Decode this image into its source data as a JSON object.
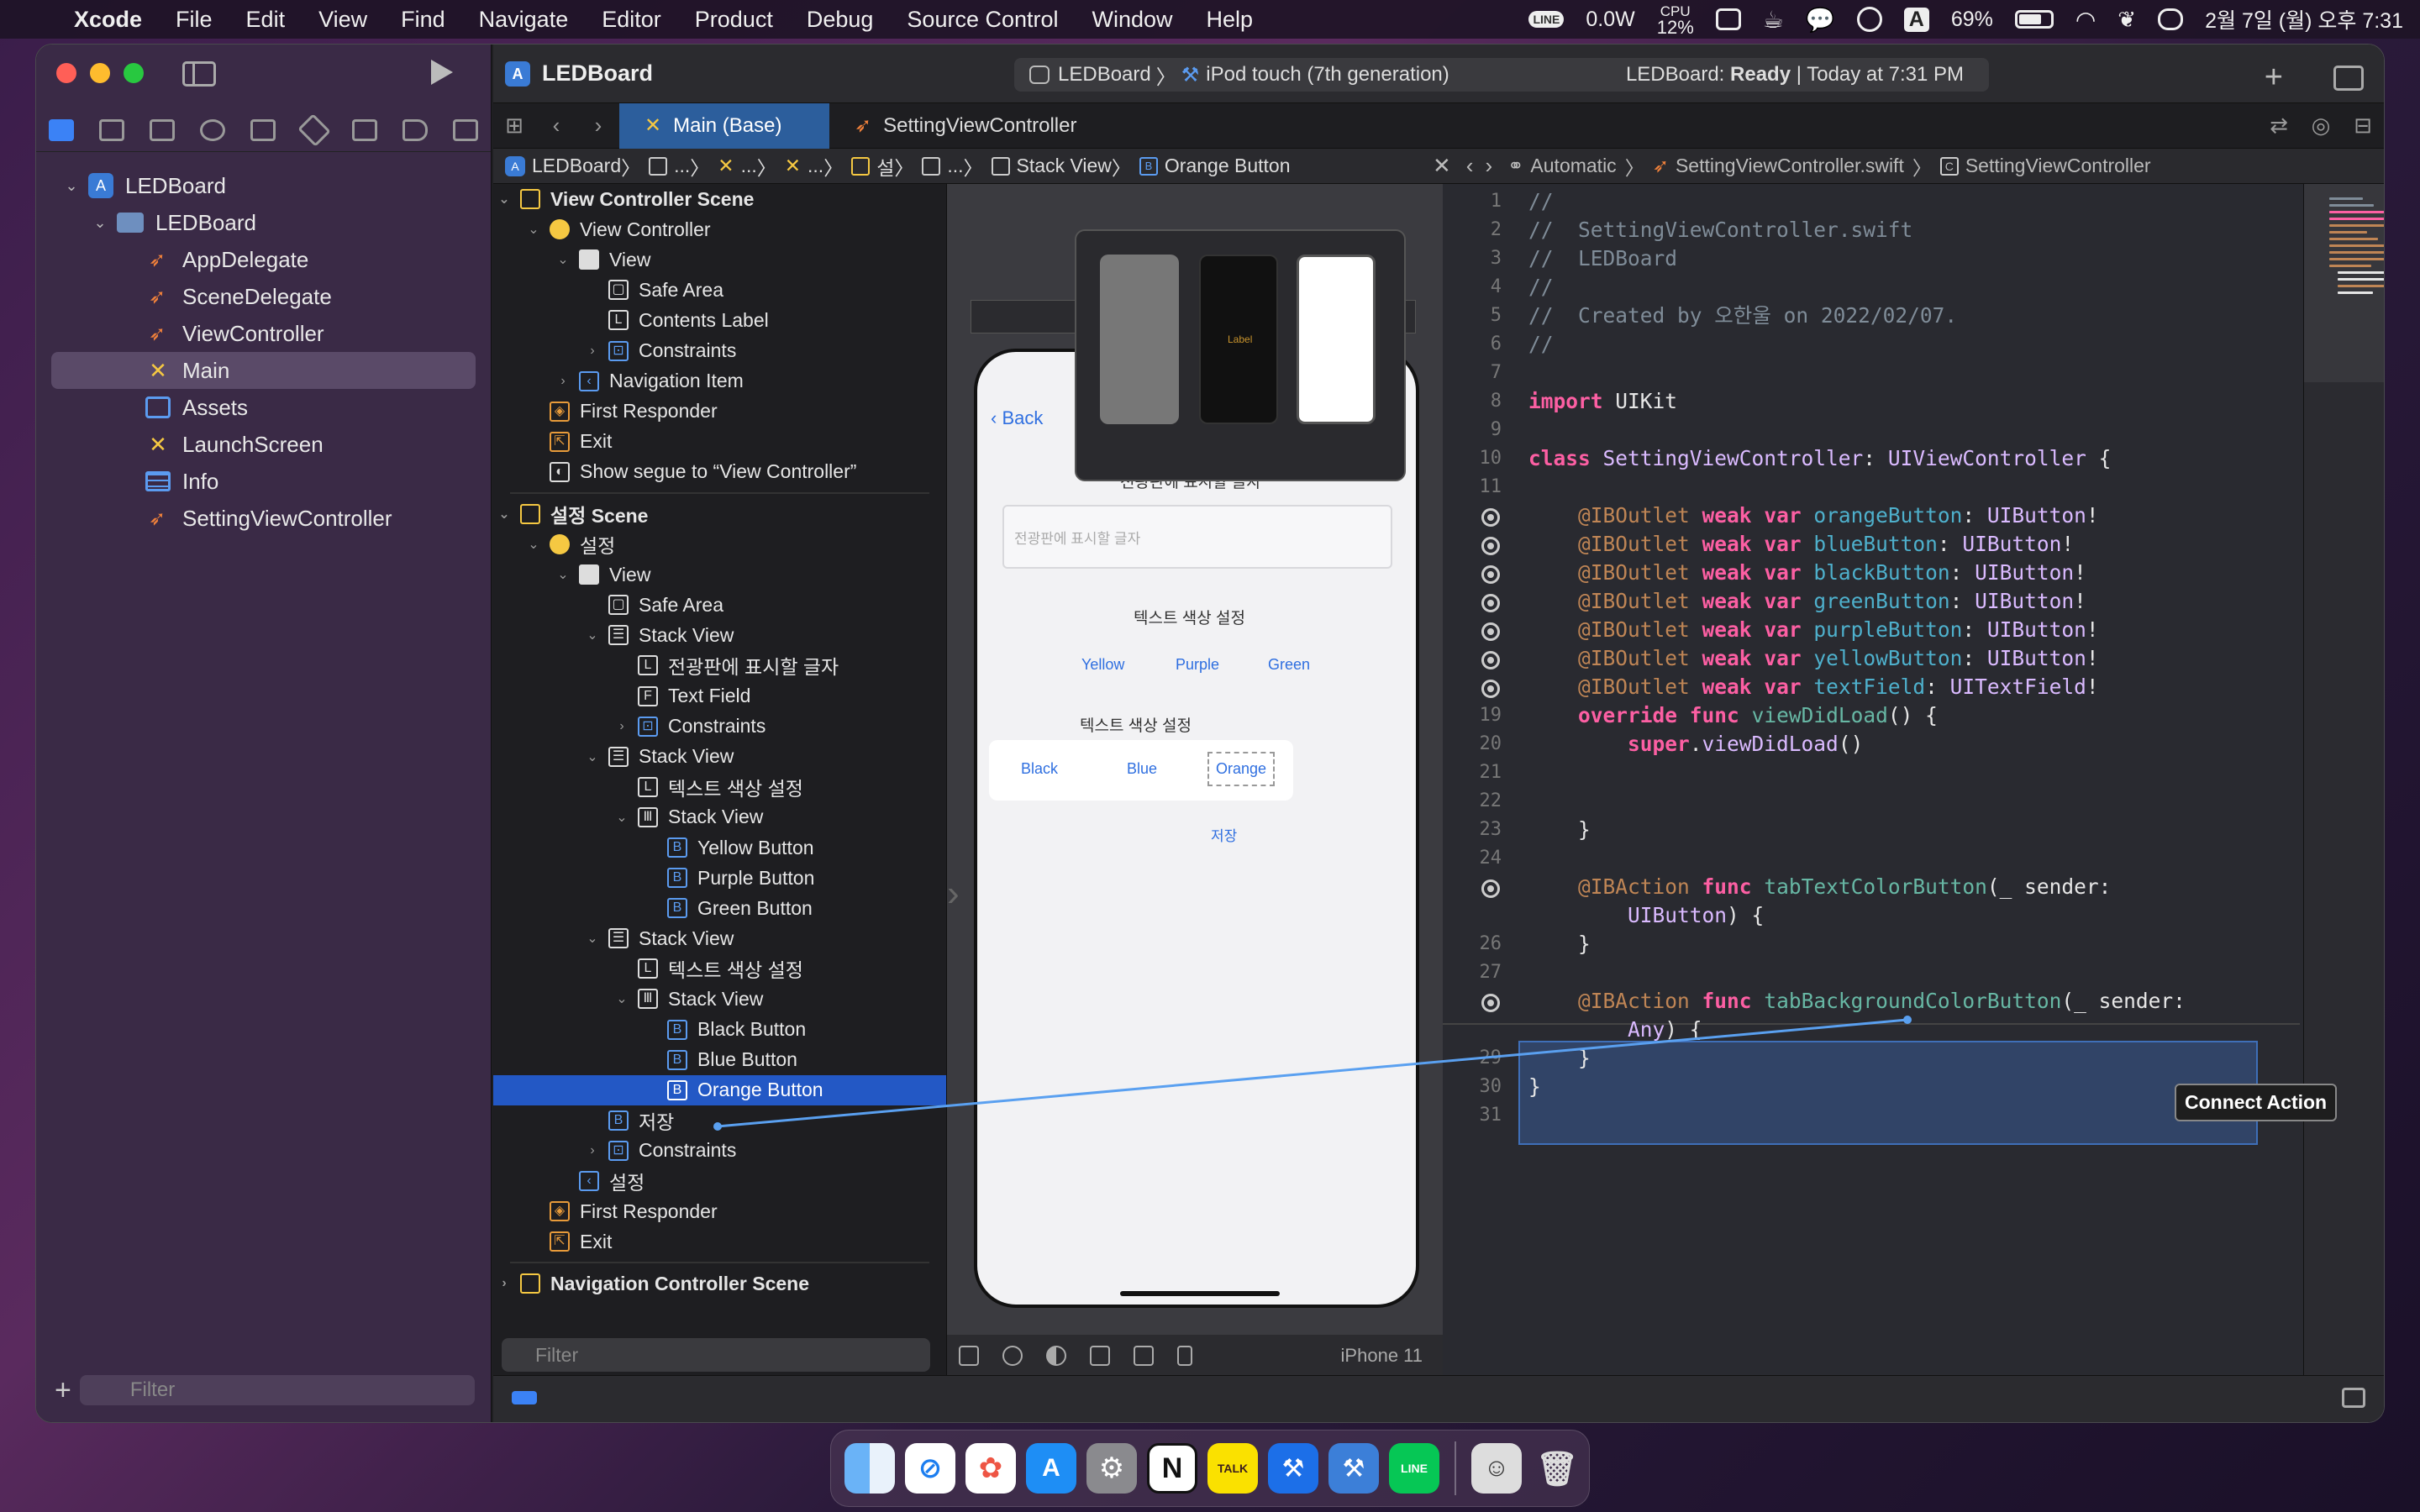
{
  "menubar": {
    "app": "Xcode",
    "items": [
      "File",
      "Edit",
      "View",
      "Find",
      "Navigate",
      "Editor",
      "Product",
      "Debug",
      "Source Control",
      "Window",
      "Help"
    ],
    "power": "0.0W",
    "cpu_label": "CPU",
    "cpu_value": "12%",
    "input_source": "A",
    "battery": "69%",
    "clock": "2월 7일 (월) 오후 7:31"
  },
  "navigator": {
    "items": [
      {
        "label": "LEDBoard",
        "kind": "project",
        "depth": 0
      },
      {
        "label": "LEDBoard",
        "kind": "folder",
        "depth": 1
      },
      {
        "label": "AppDelegate",
        "kind": "swift",
        "depth": 2
      },
      {
        "label": "SceneDelegate",
        "kind": "swift",
        "depth": 2
      },
      {
        "label": "ViewController",
        "kind": "swift",
        "depth": 2
      },
      {
        "label": "Main",
        "kind": "storyboard",
        "depth": 2,
        "selected": true
      },
      {
        "label": "Assets",
        "kind": "assets",
        "depth": 2
      },
      {
        "label": "LaunchScreen",
        "kind": "storyboard",
        "depth": 2
      },
      {
        "label": "Info",
        "kind": "plist",
        "depth": 2
      },
      {
        "label": "SettingViewController",
        "kind": "swift",
        "depth": 2
      }
    ],
    "filter_placeholder": "Filter"
  },
  "toolbar": {
    "project": "LEDBoard",
    "scheme": "LEDBoard",
    "device": "iPod touch (7th generation)",
    "status_name": "LEDBoard:",
    "status_state": "Ready",
    "status_time": "| Today at 7:31 PM"
  },
  "tabs": [
    {
      "label": "Main (Base)",
      "active": true
    },
    {
      "label": "SettingViewController",
      "active": false
    }
  ],
  "jumpbar_left": [
    "LEDBoard",
    "...",
    "...",
    "...",
    "설",
    "...",
    "Stack View",
    "Orange Button"
  ],
  "jumpbar_right": {
    "mode": "Automatic",
    "file": "SettingViewController.swift",
    "symbol": "SettingViewController"
  },
  "outline": [
    {
      "label": "View Controller Scene",
      "depth": 0,
      "icon": "scene",
      "scene": true,
      "disc": "v"
    },
    {
      "label": "View Controller",
      "depth": 1,
      "icon": "vc",
      "disc": "v"
    },
    {
      "label": "View",
      "depth": 2,
      "icon": "view",
      "disc": "v"
    },
    {
      "label": "Safe Area",
      "depth": 3,
      "icon": "safe"
    },
    {
      "label": "Contents Label",
      "depth": 3,
      "icon": "L"
    },
    {
      "label": "Constraints",
      "depth": 3,
      "icon": "constraint",
      "disc": ">"
    },
    {
      "label": "Navigation Item",
      "depth": 2,
      "icon": "<",
      "disc": ">"
    },
    {
      "label": "First Responder",
      "depth": 1,
      "icon": "responder"
    },
    {
      "label": "Exit",
      "depth": 1,
      "icon": "exit"
    },
    {
      "label": "Show segue to “View Controller”",
      "depth": 1,
      "icon": "segue"
    },
    {
      "sep": true
    },
    {
      "label": "설정 Scene",
      "depth": 0,
      "icon": "scene",
      "scene": true,
      "disc": "v"
    },
    {
      "label": "설정",
      "depth": 1,
      "icon": "vc",
      "disc": "v"
    },
    {
      "label": "View",
      "depth": 2,
      "icon": "view",
      "disc": "v"
    },
    {
      "label": "Safe Area",
      "depth": 3,
      "icon": "safe"
    },
    {
      "label": "Stack View",
      "depth": 3,
      "icon": "stack",
      "disc": "v"
    },
    {
      "label": "전광판에 표시할 글자",
      "depth": 4,
      "icon": "L"
    },
    {
      "label": "Text Field",
      "depth": 4,
      "icon": "F"
    },
    {
      "label": "Constraints",
      "depth": 4,
      "icon": "constraint",
      "disc": ">"
    },
    {
      "label": "Stack View",
      "depth": 3,
      "icon": "stack",
      "disc": "v"
    },
    {
      "label": "텍스트 색상 설정",
      "depth": 4,
      "icon": "L"
    },
    {
      "label": "Stack View",
      "depth": 4,
      "icon": "hstack",
      "disc": "v"
    },
    {
      "label": "Yellow Button",
      "depth": 5,
      "icon": "B"
    },
    {
      "label": "Purple Button",
      "depth": 5,
      "icon": "B"
    },
    {
      "label": "Green Button",
      "depth": 5,
      "icon": "B"
    },
    {
      "label": "Stack View",
      "depth": 3,
      "icon": "stack",
      "disc": "v"
    },
    {
      "label": "텍스트 색상 설정",
      "depth": 4,
      "icon": "L"
    },
    {
      "label": "Stack View",
      "depth": 4,
      "icon": "hstack",
      "disc": "v"
    },
    {
      "label": "Black Button",
      "depth": 5,
      "icon": "B"
    },
    {
      "label": "Blue Button",
      "depth": 5,
      "icon": "B"
    },
    {
      "label": "Orange Button",
      "depth": 5,
      "icon": "B",
      "selected": true
    },
    {
      "label": "저장",
      "depth": 3,
      "icon": "B"
    },
    {
      "label": "Constraints",
      "depth": 3,
      "icon": "constraint",
      "disc": ">"
    },
    {
      "label": "설정",
      "depth": 2,
      "icon": "<"
    },
    {
      "label": "First Responder",
      "depth": 1,
      "icon": "responder"
    },
    {
      "label": "Exit",
      "depth": 1,
      "icon": "exit"
    },
    {
      "sep": true
    },
    {
      "label": "Navigation Controller Scene",
      "depth": 0,
      "icon": "scene",
      "scene": true,
      "disc": ">"
    }
  ],
  "outline_filter": "Filter",
  "canvas": {
    "back": "Back",
    "heading1": "전광판에 표시할 글자",
    "field_placeholder": "전광판에 표시할 글자",
    "heading2": "텍스트 색상 설정",
    "row1": [
      "Yellow",
      "Purple",
      "Green"
    ],
    "heading3": "텍스트 색상 설정",
    "row2": [
      "Black",
      "Blue",
      "Orange"
    ],
    "save": "저장",
    "preview_label": "Label",
    "device": "iPhone 11"
  },
  "code": [
    {
      "n": "1",
      "html": "<span class='cmt'>//</span>"
    },
    {
      "n": "2",
      "html": "<span class='cmt'>//  SettingViewController.swift</span>"
    },
    {
      "n": "3",
      "html": "<span class='cmt'>//  LEDBoard</span>"
    },
    {
      "n": "4",
      "html": "<span class='cmt'>//</span>"
    },
    {
      "n": "5",
      "html": "<span class='cmt'>//  Created by 오한울 on 2022/02/07.</span>"
    },
    {
      "n": "6",
      "html": "<span class='cmt'>//</span>"
    },
    {
      "n": "7",
      "html": ""
    },
    {
      "n": "8",
      "html": "<span class='kw'>import</span> UIKit"
    },
    {
      "n": "9",
      "html": ""
    },
    {
      "n": "10",
      "html": "<span class='kw'>class</span> <span class='ty'>SettingViewController</span>: <span class='ty'>UIViewController</span> {"
    },
    {
      "n": "11",
      "html": ""
    },
    {
      "n": "",
      "dot": true,
      "html": "    <span class='attr'>@IBOutlet</span> <span class='kw'>weak</span> <span class='kw'>var</span> <span class='var'>orangeButton</span>: <span class='ty'>UIButton</span>!"
    },
    {
      "n": "",
      "dot": true,
      "html": "    <span class='attr'>@IBOutlet</span> <span class='kw'>weak</span> <span class='kw'>var</span> <span class='var'>blueButton</span>: <span class='ty'>UIButton</span>!"
    },
    {
      "n": "",
      "dot": true,
      "html": "    <span class='attr'>@IBOutlet</span> <span class='kw'>weak</span> <span class='kw'>var</span> <span class='var'>blackButton</span>: <span class='ty'>UIButton</span>!"
    },
    {
      "n": "",
      "dot": true,
      "html": "    <span class='attr'>@IBOutlet</span> <span class='kw'>weak</span> <span class='kw'>var</span> <span class='var'>greenButton</span>: <span class='ty'>UIButton</span>!"
    },
    {
      "n": "",
      "dot": true,
      "html": "    <span class='attr'>@IBOutlet</span> <span class='kw'>weak</span> <span class='kw'>var</span> <span class='var'>purpleButton</span>: <span class='ty'>UIButton</span>!"
    },
    {
      "n": "",
      "dot": true,
      "html": "    <span class='attr'>@IBOutlet</span> <span class='kw'>weak</span> <span class='kw'>var</span> <span class='var'>yellowButton</span>: <span class='ty'>UIButton</span>!"
    },
    {
      "n": "",
      "dot": true,
      "html": "    <span class='attr'>@IBOutlet</span> <span class='kw'>weak</span> <span class='kw'>var</span> <span class='var'>textField</span>: <span class='ty'>UITextField</span>!"
    },
    {
      "n": "19",
      "html": "    <span class='kw'>override</span> <span class='kw'>func</span> <span class='fn'>viewDidLoad</span>() {"
    },
    {
      "n": "20",
      "html": "        <span class='kw'>super</span>.<span class='ty'>viewDidLoad</span>()"
    },
    {
      "n": "21",
      "html": ""
    },
    {
      "n": "22",
      "html": ""
    },
    {
      "n": "23",
      "html": "    }"
    },
    {
      "n": "24",
      "html": ""
    },
    {
      "n": "",
      "dot": true,
      "html": "    <span class='attr'>@IBAction</span> <span class='kw'>func</span> <span class='fn'>tabTextColorButton</span>(_ sender:"
    },
    {
      "n": "",
      "html": "        <span class='ty'>UIButton</span>) {"
    },
    {
      "n": "26",
      "html": "    }"
    },
    {
      "n": "27",
      "html": ""
    },
    {
      "n": "",
      "dot": true,
      "html": "    <span class='attr'>@IBAction</span> <span class='kw'>func</span> <span class='fn'>tabBackgroundColorButton</span>(_ sender:"
    },
    {
      "n": "",
      "html": "        <span class='ty'>Any</span>) {"
    },
    {
      "n": "29",
      "html": "    }"
    },
    {
      "n": "30",
      "html": "}"
    },
    {
      "n": "31",
      "html": ""
    }
  ],
  "connect_tip": "Connect Action",
  "colors": {
    "accent": "#2358c5",
    "swift_orange": "#f0813b",
    "keyword": "#fc5fa3",
    "type": "#dabaff"
  },
  "dock": [
    "finder-icon",
    "safari-icon",
    "photos-icon",
    "app-store-icon",
    "system-preferences-icon",
    "notion-icon",
    "kakaotalk-icon",
    "xcode-icon",
    "xcode-beta-icon",
    "line-icon",
    "user-photo-icon",
    "trash-icon"
  ]
}
